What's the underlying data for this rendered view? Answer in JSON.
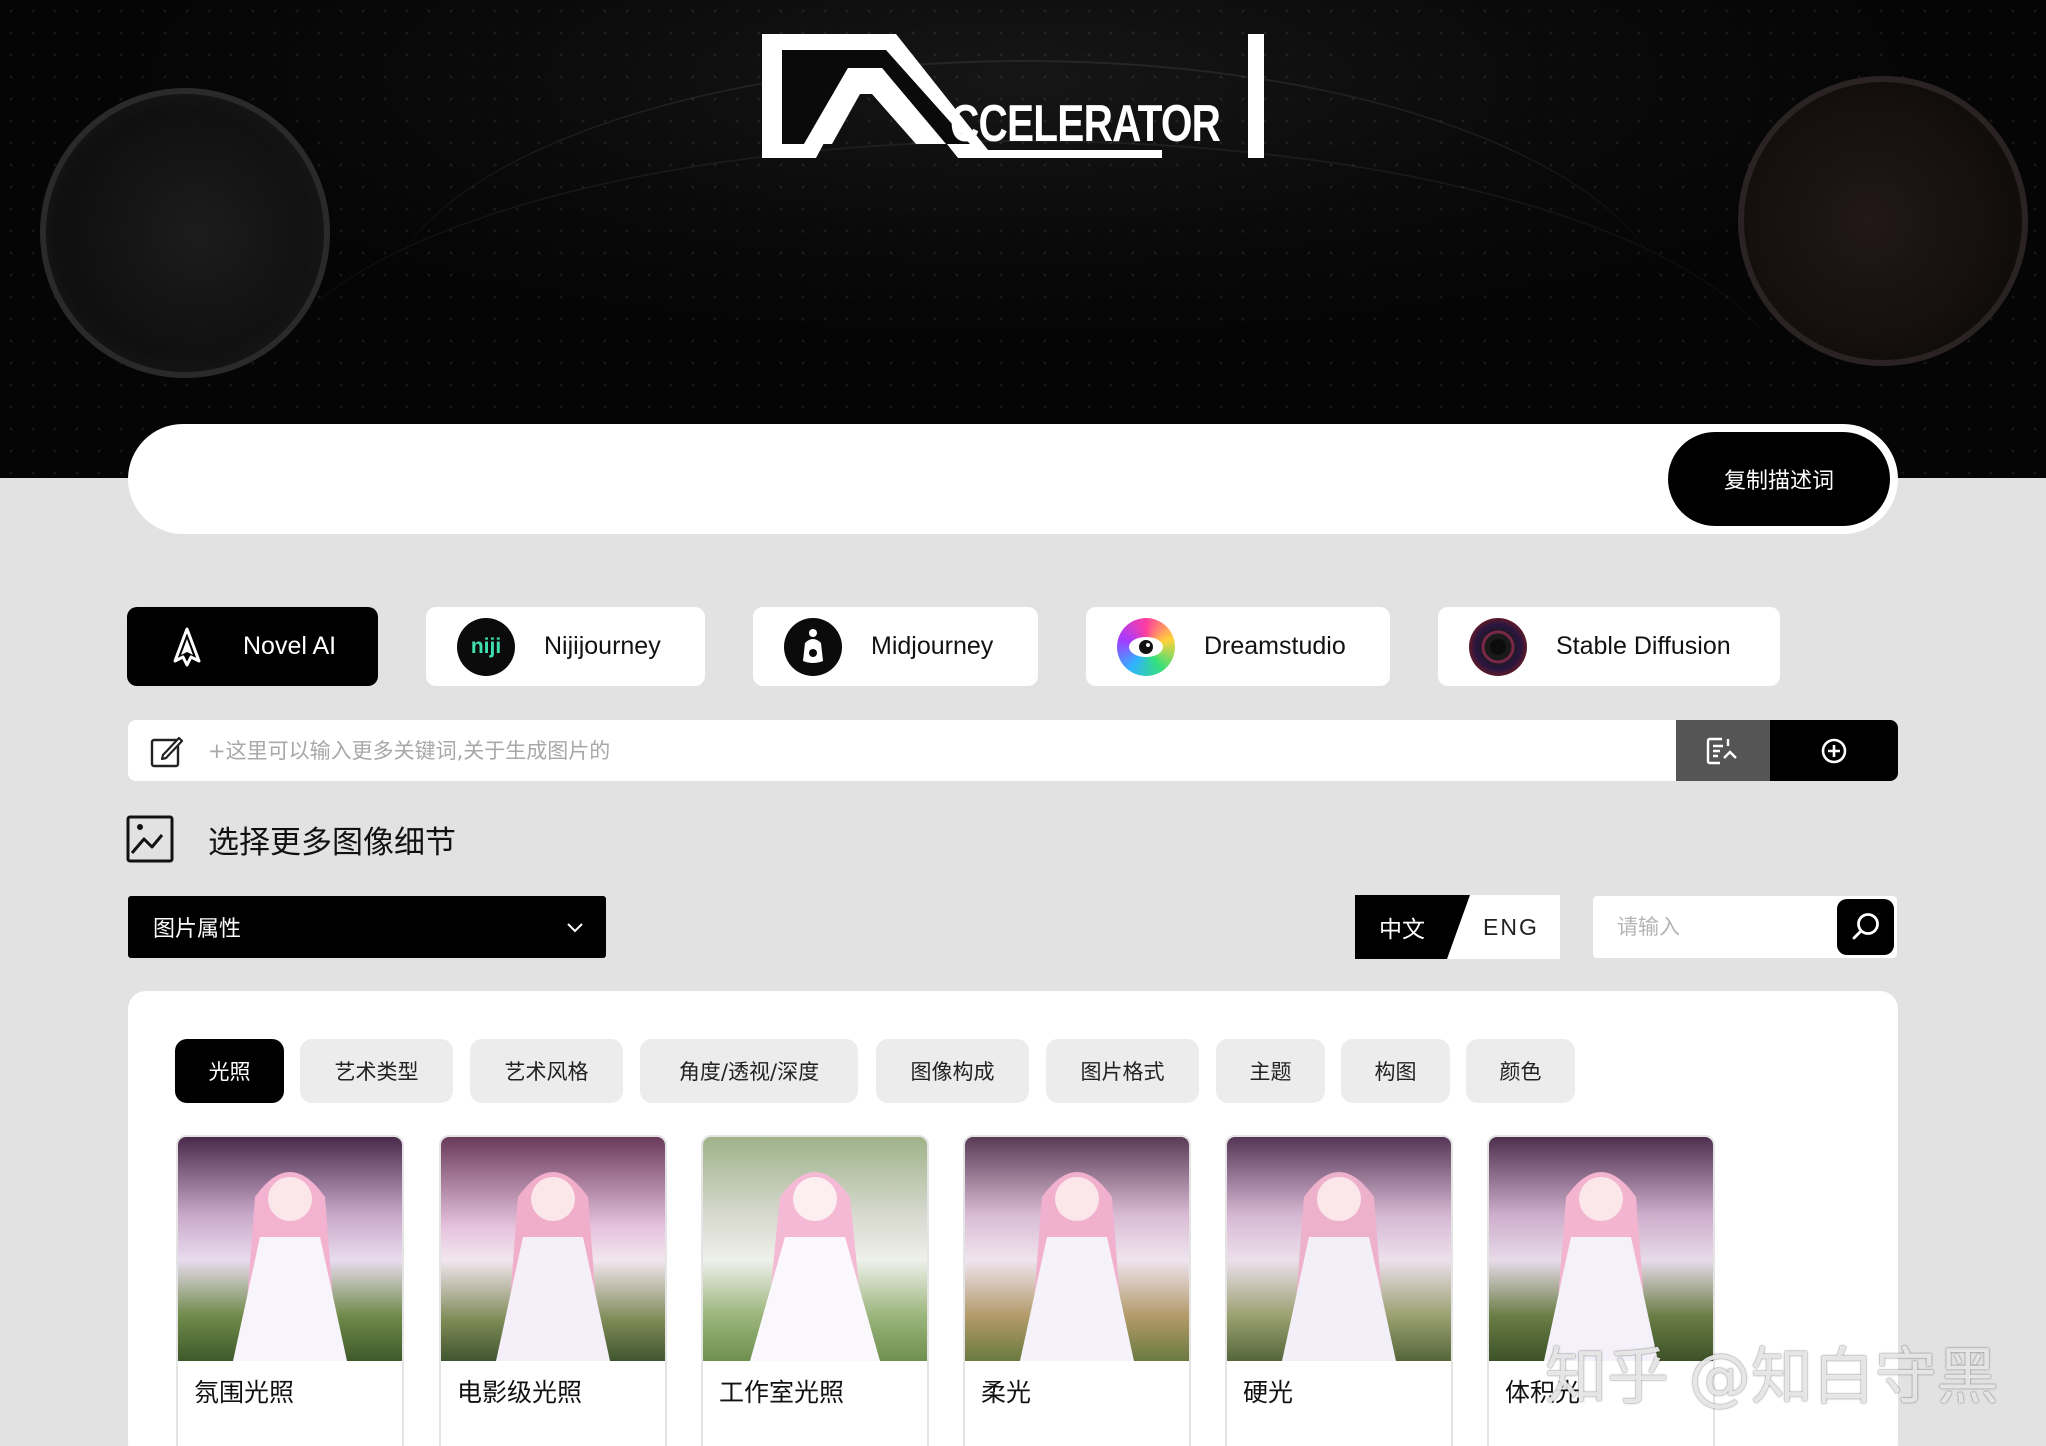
{
  "header": {
    "logo_text": "CCELERATOR"
  },
  "prompt": {
    "value": "",
    "copy_label": "复制描述词"
  },
  "models": [
    {
      "label": "Novel AI",
      "icon": "novelai-logo-icon",
      "active": true
    },
    {
      "label": "Nijijourney",
      "icon": "niji-logo-icon",
      "icon_text": "niji",
      "active": false
    },
    {
      "label": "Midjourney",
      "icon": "midjourney-logo-icon",
      "active": false
    },
    {
      "label": "Dreamstudio",
      "icon": "dreamstudio-logo-icon",
      "active": false
    },
    {
      "label": "Stable Diffusion",
      "icon": "stable-diffusion-logo-icon",
      "active": false
    }
  ],
  "keywords": {
    "placeholder": "+这里可以输入更多关键词,关于生成图片的",
    "value": ""
  },
  "section": {
    "title": "选择更多图像细节"
  },
  "attribute_select": {
    "selected": "图片属性"
  },
  "language": {
    "zh_label": "中文",
    "en_label": "ENG",
    "active": "中文"
  },
  "search": {
    "placeholder": "请输入",
    "value": ""
  },
  "categories": [
    {
      "label": "光照",
      "active": true
    },
    {
      "label": "艺术类型",
      "active": false
    },
    {
      "label": "艺术风格",
      "active": false
    },
    {
      "label": "角度/透视/深度",
      "active": false
    },
    {
      "label": "图像构成",
      "active": false
    },
    {
      "label": "图片格式",
      "active": false
    },
    {
      "label": "主题",
      "active": false
    },
    {
      "label": "构图",
      "active": false
    },
    {
      "label": "颜色",
      "active": false
    }
  ],
  "cards": [
    {
      "label": "氛围光照"
    },
    {
      "label": "电影级光照"
    },
    {
      "label": "工作室光照"
    },
    {
      "label": "柔光"
    },
    {
      "label": "硬光"
    },
    {
      "label": "体积光"
    }
  ],
  "watermark": "知乎 @知白守黑",
  "colors": {
    "accent": "#000000",
    "background": "#e2e2e2",
    "panel": "#ffffff",
    "inactive_tab": "#ececec"
  }
}
